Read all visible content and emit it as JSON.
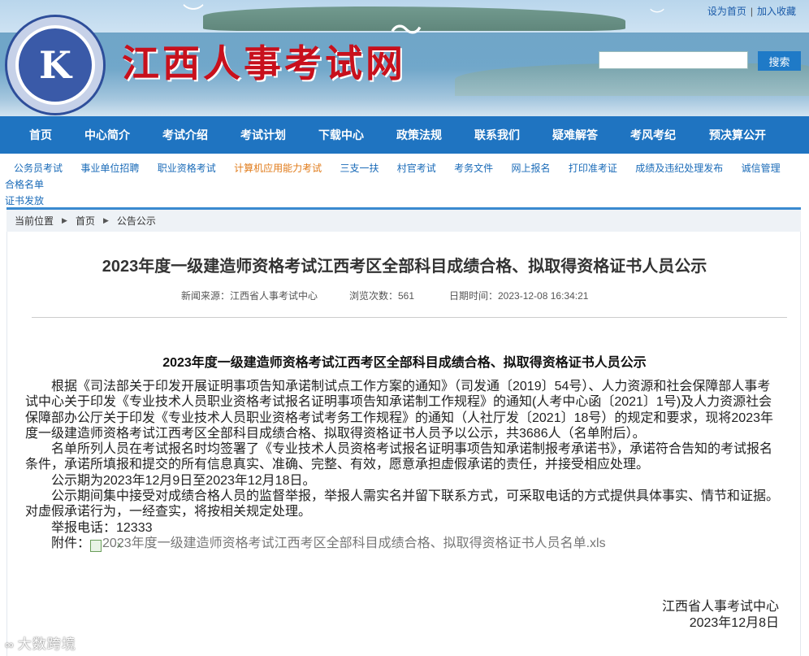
{
  "header": {
    "site_title": "江西人事考试网",
    "logo_char": "K",
    "set_home": "设为首页",
    "separator": "|",
    "add_favorite": "加入收藏",
    "search_placeholder": "",
    "search_button": "搜索"
  },
  "main_nav": [
    "首页",
    "中心简介",
    "考试介绍",
    "考试计划",
    "下载中心",
    "政策法规",
    "联系我们",
    "疑难解答",
    "考风考纪",
    "预决算公开"
  ],
  "sub_nav": {
    "items": [
      "公务员考试",
      "事业单位招聘",
      "职业资格考试",
      "计算机应用能力考试",
      "三支一扶",
      "村官考试",
      "考务文件",
      "网上报名",
      "打印准考证",
      "成绩及违纪处理发布",
      "诚信管理",
      "合格名单",
      "证书发放"
    ],
    "active_index": 3,
    "active_color": "#e07b1a"
  },
  "breadcrumb": {
    "label": "当前位置",
    "home": "首页",
    "current": "公告公示",
    "arrow": "▶"
  },
  "article": {
    "title": "2023年度一级建造师资格考试江西考区全部科目成绩合格、拟取得资格证书人员公示",
    "source": "新闻来源：江西省人事考试中心",
    "views": "浏览次数：561",
    "date": "日期时间：2023-12-08 16:34:21",
    "subtitle": "2023年度一级建造师资格考试江西考区全部科目成绩合格、拟取得资格证书人员公示",
    "paragraphs": [
      "根据《司法部关于印发开展证明事项告知承诺制试点工作方案的通知》（司发通〔2019〕54号）、人力资源和社会保障部人事考试中心关于印发《专业技术人员职业资格考试报名证明事项告知承诺制工作规程》的通知(人考中心函〔2021〕1号)及人力资源社会保障部办公厅关于印发《专业技术人员职业资格考试考务工作规程》的通知（人社厅发〔2021〕18号）的规定和要求，现将2023年度一级建造师资格考试江西考区全部科目成绩合格、拟取得资格证书人员予以公示，共3686人（名单附后）。",
      "名单所列人员在考试报名时均签署了《专业技术人员资格考试报名证明事项告知承诺制报考承诺书》，承诺符合告知的考试报名条件，承诺所填报和提交的所有信息真实、准确、完整、有效，愿意承担虚假承诺的责任，并接受相应处理。",
      "公示期为2023年12月9日至2023年12月18日。",
      "公示期间集中接受对成绩合格人员的监督举报，举报人需实名并留下联系方式，可采取电话的方式提供具体事实、情节和证据。对虚假承诺行为，一经查实，将按相关规定处理。",
      "举报电话：12333"
    ],
    "attachment_label": "附件：",
    "attachment_icon": "excel-file-icon",
    "attachment_name": "2023年度一级建造师资格考试江西考区全部科目成绩合格、拟取得资格证书人员名单.xls",
    "sign_org": "江西省人事考试中心",
    "sign_date": "2023年12月8日"
  },
  "watermark": "大数跨境"
}
